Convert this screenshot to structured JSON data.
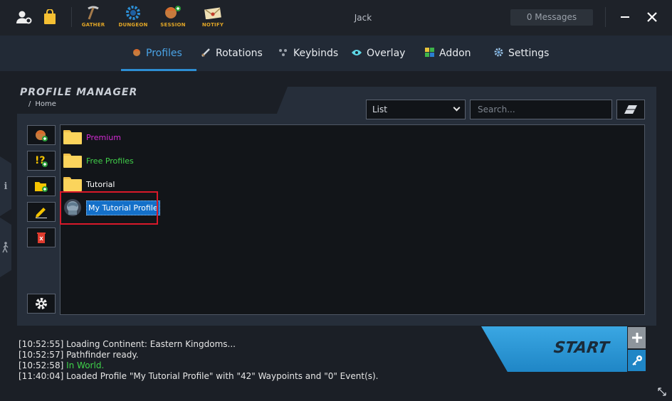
{
  "topbar": {
    "tools": [
      {
        "label": "GATHER",
        "icon": "pickaxe-icon"
      },
      {
        "label": "DUNGEON",
        "icon": "gear-portal-icon"
      },
      {
        "label": "SESSION",
        "icon": "character-add-icon"
      },
      {
        "label": "NOTIFY",
        "icon": "envelope-icon"
      }
    ],
    "user_name": "Jack",
    "messages_label": "0 Messages"
  },
  "tabs": [
    {
      "label": "Profiles",
      "icon": "profile-icon",
      "active": true
    },
    {
      "label": "Rotations",
      "icon": "sword-icon",
      "active": false
    },
    {
      "label": "Keybinds",
      "icon": "keybind-icon",
      "active": false
    },
    {
      "label": "Overlay",
      "icon": "eye-icon",
      "active": false
    },
    {
      "label": "Addon",
      "icon": "addon-icon",
      "active": false
    },
    {
      "label": "Settings",
      "icon": "gear-icon",
      "active": false
    }
  ],
  "profile_manager": {
    "title": "PROFILE MANAGER",
    "breadcrumb_sep": "/",
    "breadcrumb": "Home",
    "view_select": "List",
    "search_placeholder": "Search...",
    "items": [
      {
        "type": "folder",
        "name": "Premium",
        "color": "#d42ad4"
      },
      {
        "type": "folder",
        "name": "Free Profiles",
        "color": "#41d14a"
      },
      {
        "type": "folder",
        "name": "Tutorial",
        "color": "#ffffff"
      },
      {
        "type": "profile",
        "name": "My Tutorial Profile",
        "color": "#ffffff",
        "selected": true
      }
    ]
  },
  "side_tabs": [
    "i",
    "walk"
  ],
  "log": [
    {
      "time": "[10:52:55]",
      "text": "Loading Continent: Eastern Kingdoms...",
      "status": "normal"
    },
    {
      "time": "[10:52:57]",
      "text": "Pathfinder ready.",
      "status": "normal"
    },
    {
      "time": "[10:52:58]",
      "text": "In World.",
      "status": "ok"
    },
    {
      "time": "[11:40:04]",
      "text": "Loaded Profile \"My Tutorial Profile\" with \"42\" Waypoints and \"0\" Event(s).",
      "status": "normal"
    }
  ],
  "start_label": "START",
  "colors": {
    "accent": "#2d8ed3",
    "gold": "#e0a526",
    "success": "#3fd34a",
    "selection_outline": "#d8192a"
  }
}
